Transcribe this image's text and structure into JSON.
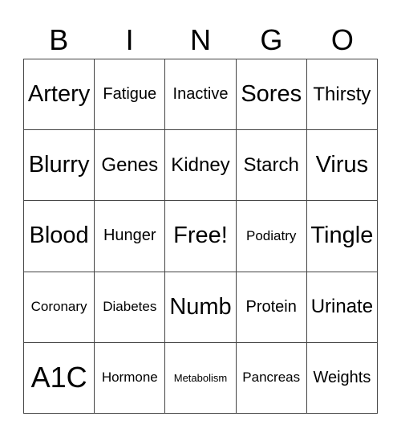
{
  "header": [
    "B",
    "I",
    "N",
    "G",
    "O"
  ],
  "rows": [
    [
      {
        "text": "Artery",
        "size": "s-l"
      },
      {
        "text": "Fatigue",
        "size": "s-s"
      },
      {
        "text": "Inactive",
        "size": "s-s"
      },
      {
        "text": "Sores",
        "size": "s-l"
      },
      {
        "text": "Thirsty",
        "size": "s-m"
      }
    ],
    [
      {
        "text": "Blurry",
        "size": "s-l"
      },
      {
        "text": "Genes",
        "size": "s-m"
      },
      {
        "text": "Kidney",
        "size": "s-m"
      },
      {
        "text": "Starch",
        "size": "s-m"
      },
      {
        "text": "Virus",
        "size": "s-l"
      }
    ],
    [
      {
        "text": "Blood",
        "size": "s-l"
      },
      {
        "text": "Hunger",
        "size": "s-s"
      },
      {
        "text": "Free!",
        "size": "s-l"
      },
      {
        "text": "Podiatry",
        "size": "s-xs"
      },
      {
        "text": "Tingle",
        "size": "s-l"
      }
    ],
    [
      {
        "text": "Coronary",
        "size": "s-xs"
      },
      {
        "text": "Diabetes",
        "size": "s-xs"
      },
      {
        "text": "Numb",
        "size": "s-l"
      },
      {
        "text": "Protein",
        "size": "s-s"
      },
      {
        "text": "Urinate",
        "size": "s-m"
      }
    ],
    [
      {
        "text": "A1C",
        "size": "s-xl"
      },
      {
        "text": "Hormone",
        "size": "s-xs"
      },
      {
        "text": "Metabolism",
        "size": "s-xxs"
      },
      {
        "text": "Pancreas",
        "size": "s-xs"
      },
      {
        "text": "Weights",
        "size": "s-s"
      }
    ]
  ]
}
